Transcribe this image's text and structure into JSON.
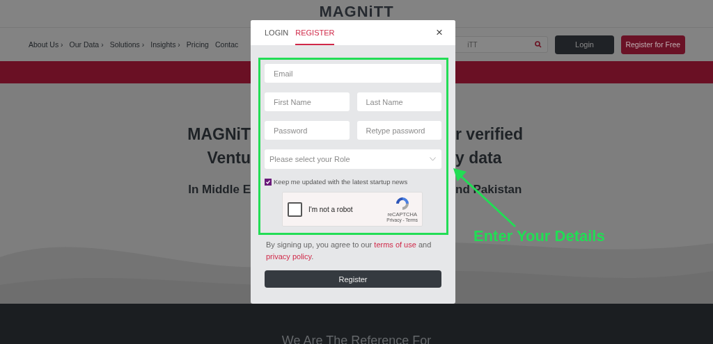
{
  "header": {
    "logo": "MAGNiTT"
  },
  "nav": {
    "items": [
      "About Us ›",
      "Our Data ›",
      "Solutions ›",
      "Insights ›",
      "Pricing",
      "Contac"
    ],
    "search": {
      "placeholder": "iTT"
    },
    "buttons": [
      {
        "label": "Login",
        "kind": "dark"
      },
      {
        "label": "Register for Free",
        "kind": "accent"
      }
    ]
  },
  "hero": {
    "lines": [
      {
        "left": "MAGNiT",
        "right": "r verified",
        "kind": "title"
      },
      {
        "left": "Ventu",
        "right": "y data",
        "kind": "title"
      },
      {
        "left": "In Middle E",
        "right": "nd Pakistan",
        "kind": "subtitle"
      }
    ]
  },
  "modal": {
    "tabs": [
      {
        "label": "LOGIN",
        "selected": false
      },
      {
        "label": "REGISTER",
        "selected": true
      }
    ],
    "close": "×",
    "fields": [
      {
        "placeholder": "Email",
        "kind": "text"
      },
      {
        "placeholder": "First Name",
        "kind": "text"
      },
      {
        "placeholder": "Last Name",
        "kind": "text"
      },
      {
        "placeholder": "Password",
        "kind": "text"
      },
      {
        "placeholder": "Retype password",
        "kind": "text"
      },
      {
        "placeholder": "Please select your Role",
        "kind": "select"
      }
    ],
    "newsletter": {
      "label": "Keep me updated with the latest startup news",
      "checked": true
    },
    "captcha": {
      "label": "I'm not a robot",
      "checked": false,
      "brand": "reCAPTCHA",
      "links": "Privacy - Terms"
    },
    "consent": [
      {
        "text": "By signing up, you agree to our ",
        "kind": "text"
      },
      {
        "text": "terms of use",
        "kind": "link"
      },
      {
        "text": " and ",
        "kind": "text"
      },
      {
        "text": "privacy policy",
        "kind": "link"
      },
      {
        "text": ".",
        "kind": "text"
      }
    ],
    "submit": "Register"
  },
  "annotation": {
    "label": "Enter Your Details"
  },
  "footer": {
    "heading": "We Are The Reference For"
  }
}
